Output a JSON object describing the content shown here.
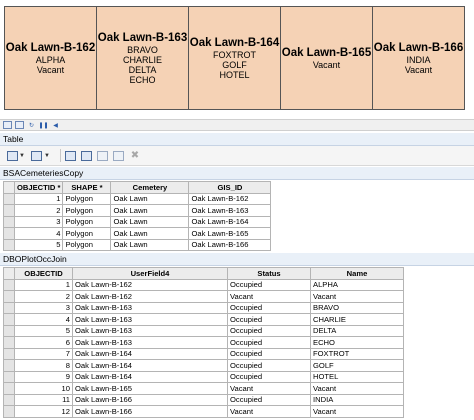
{
  "plots": [
    {
      "title": "Oak Lawn-B-162",
      "occupants": [
        "ALPHA",
        "Vacant"
      ]
    },
    {
      "title": "Oak Lawn-B-163",
      "occupants": [
        "BRAVO",
        "CHARLIE",
        "DELTA",
        "ECHO"
      ]
    },
    {
      "title": "Oak Lawn-B-164",
      "occupants": [
        "FOXTROT",
        "GOLF",
        "HOTEL"
      ]
    },
    {
      "title": "Oak Lawn-B-165",
      "occupants": [
        "Vacant"
      ]
    },
    {
      "title": "Oak Lawn-B-166",
      "occupants": [
        "INDIA",
        "Vacant"
      ]
    }
  ],
  "window": {
    "title": "Table"
  },
  "table1": {
    "tab": "BSACemeteriesCopy",
    "columns": [
      "OBJECTID *",
      "SHAPE *",
      "Cemetery",
      "GIS_ID"
    ],
    "rows": [
      [
        "1",
        "Polygon",
        "Oak Lawn",
        "Oak Lawn-B-162"
      ],
      [
        "2",
        "Polygon",
        "Oak Lawn",
        "Oak Lawn-B-163"
      ],
      [
        "3",
        "Polygon",
        "Oak Lawn",
        "Oak Lawn-B-164"
      ],
      [
        "4",
        "Polygon",
        "Oak Lawn",
        "Oak Lawn-B-165"
      ],
      [
        "5",
        "Polygon",
        "Oak Lawn",
        "Oak Lawn-B-166"
      ]
    ]
  },
  "table2": {
    "tab": "DBOPlotOccJoin",
    "columns": [
      "OBJECTID",
      "UserField4",
      "Status",
      "Name"
    ],
    "rows": [
      [
        "1",
        "Oak Lawn-B-162",
        "Occupied",
        "ALPHA"
      ],
      [
        "2",
        "Oak Lawn-B-162",
        "Vacant",
        "Vacant"
      ],
      [
        "3",
        "Oak Lawn-B-163",
        "Occupied",
        "BRAVO"
      ],
      [
        "4",
        "Oak Lawn-B-163",
        "Occupied",
        "CHARLIE"
      ],
      [
        "5",
        "Oak Lawn-B-163",
        "Occupied",
        "DELTA"
      ],
      [
        "6",
        "Oak Lawn-B-163",
        "Occupied",
        "ECHO"
      ],
      [
        "7",
        "Oak Lawn-B-164",
        "Occupied",
        "FOXTROT"
      ],
      [
        "8",
        "Oak Lawn-B-164",
        "Occupied",
        "GOLF"
      ],
      [
        "9",
        "Oak Lawn-B-164",
        "Occupied",
        "HOTEL"
      ],
      [
        "10",
        "Oak Lawn-B-165",
        "Vacant",
        "Vacant"
      ],
      [
        "11",
        "Oak Lawn-B-166",
        "Occupied",
        "INDIA"
      ],
      [
        "12",
        "Oak Lawn-B-166",
        "Vacant",
        "Vacant"
      ]
    ]
  }
}
